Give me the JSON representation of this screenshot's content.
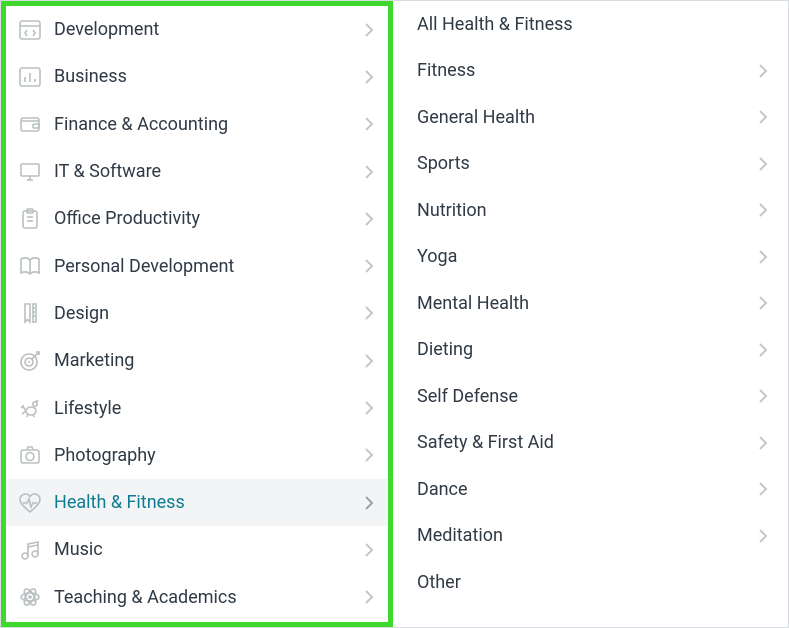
{
  "colors": {
    "highlight_border": "#3fd82d",
    "selected_bg": "#f3f4f5",
    "selected_text": "#0f7c90",
    "text": "#2f3a45",
    "icon": "#b9bfc2"
  },
  "left": {
    "highlighted": true,
    "selected_index": 10,
    "items": [
      {
        "label": "Development",
        "icon": "code-window-icon",
        "has_children": true
      },
      {
        "label": "Business",
        "icon": "bar-chart-icon",
        "has_children": true
      },
      {
        "label": "Finance & Accounting",
        "icon": "wallet-icon",
        "has_children": true
      },
      {
        "label": "IT & Software",
        "icon": "monitor-icon",
        "has_children": true
      },
      {
        "label": "Office Productivity",
        "icon": "clipboard-icon",
        "has_children": true
      },
      {
        "label": "Personal Development",
        "icon": "book-open-icon",
        "has_children": true
      },
      {
        "label": "Design",
        "icon": "pencil-ruler-icon",
        "has_children": true
      },
      {
        "label": "Marketing",
        "icon": "target-icon",
        "has_children": true
      },
      {
        "label": "Lifestyle",
        "icon": "pet-icon",
        "has_children": true
      },
      {
        "label": "Photography",
        "icon": "camera-icon",
        "has_children": true
      },
      {
        "label": "Health & Fitness",
        "icon": "heart-pulse-icon",
        "has_children": true
      },
      {
        "label": "Music",
        "icon": "music-note-icon",
        "has_children": true
      },
      {
        "label": "Teaching & Academics",
        "icon": "atom-icon",
        "has_children": true
      }
    ]
  },
  "right": {
    "items": [
      {
        "label": "All Health & Fitness",
        "has_children": false
      },
      {
        "label": "Fitness",
        "has_children": true
      },
      {
        "label": "General Health",
        "has_children": true
      },
      {
        "label": "Sports",
        "has_children": true
      },
      {
        "label": "Nutrition",
        "has_children": true
      },
      {
        "label": "Yoga",
        "has_children": true
      },
      {
        "label": "Mental Health",
        "has_children": true
      },
      {
        "label": "Dieting",
        "has_children": true
      },
      {
        "label": "Self Defense",
        "has_children": true
      },
      {
        "label": "Safety & First Aid",
        "has_children": true
      },
      {
        "label": "Dance",
        "has_children": true
      },
      {
        "label": "Meditation",
        "has_children": true
      },
      {
        "label": "Other",
        "has_children": false
      }
    ]
  }
}
